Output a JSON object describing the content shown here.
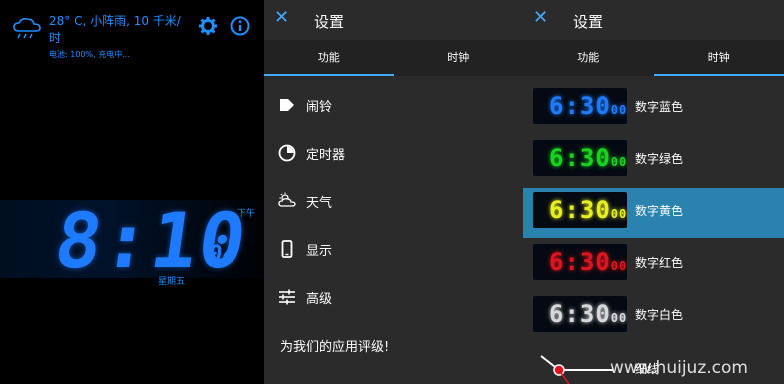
{
  "left": {
    "weather_text": "28° C, 小阵雨, 10 千米/时",
    "battery": "电池: 100%, 充电中...",
    "time": "8:10",
    "seconds": "04",
    "ampm": "下午",
    "weekday": "星期五",
    "accent": "#1e8fff"
  },
  "settings": {
    "title": "设置",
    "tabs": [
      "功能",
      "时钟"
    ],
    "active_tab": "功能",
    "menu": [
      "闹铃",
      "定时器",
      "天气",
      "显示",
      "高级"
    ],
    "rate": "为我们的应用评级!"
  },
  "clock": {
    "title": "设置",
    "tabs": [
      "功能",
      "时钟"
    ],
    "active_tab": "时钟",
    "preview_time": "6:30",
    "preview_sec": "00",
    "styles": [
      {
        "label": "数字蓝色",
        "color": "#1e7bff"
      },
      {
        "label": "数字绿色",
        "color": "#18d41e"
      },
      {
        "label": "数字黄色",
        "color": "#e8ef1f",
        "selected": true
      },
      {
        "label": "数字红色",
        "color": "#e0141c"
      },
      {
        "label": "数字白色",
        "color": "#d8d8d8"
      }
    ],
    "partial": "细线"
  },
  "watermark": "www.huijuz.com",
  "colors": {
    "panel_bg": "#2b2b2b",
    "accent": "#41a9ff",
    "selected_row": "#2a82ae"
  }
}
